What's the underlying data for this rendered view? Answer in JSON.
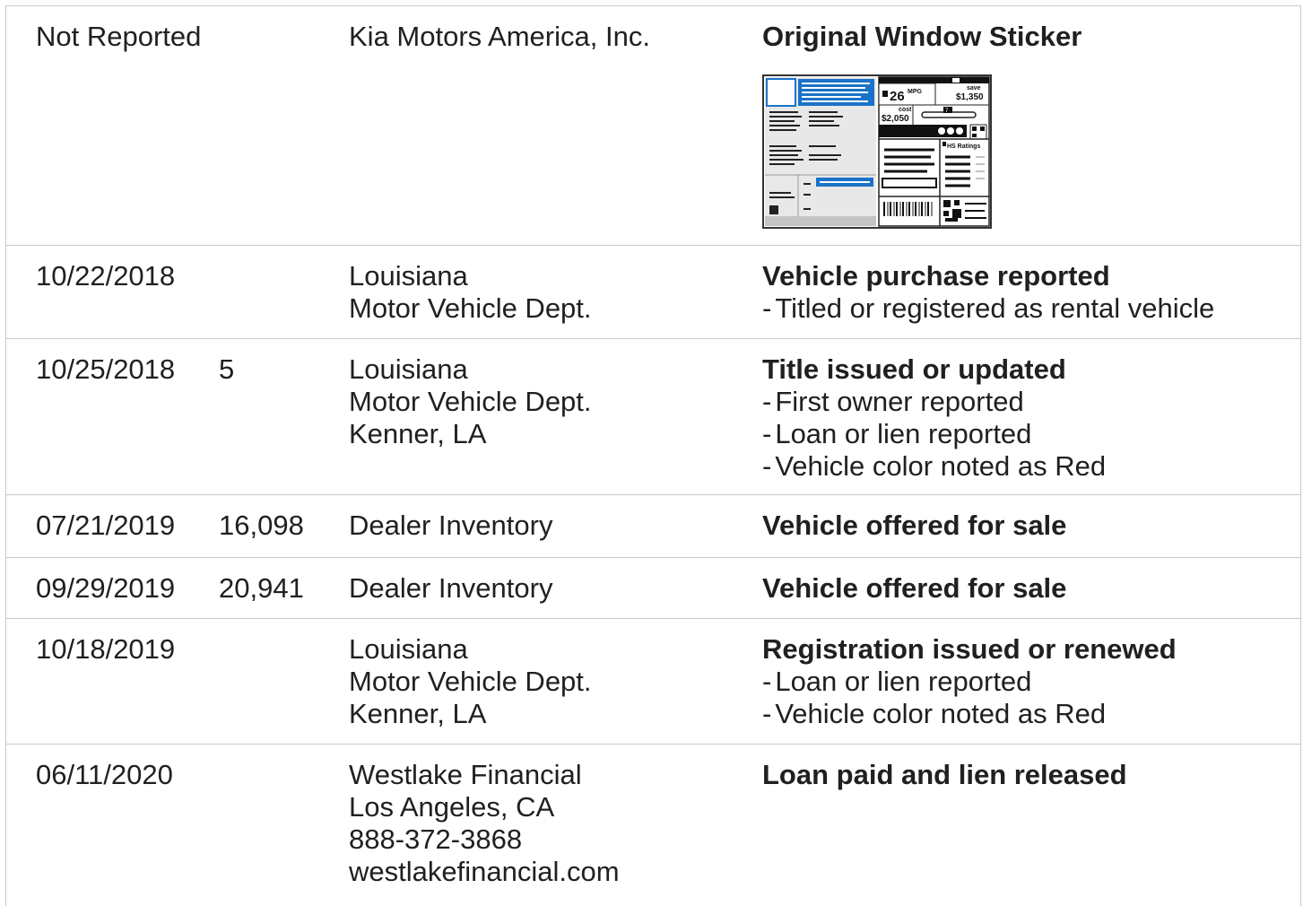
{
  "rows": [
    {
      "date": "Not Reported",
      "odometer": "",
      "source": [
        "Kia Motors America, Inc."
      ],
      "comment_title": "Original Window Sticker",
      "comment_details": [],
      "sticker": {
        "mpg": "26",
        "mpg_unit": "MPG",
        "save_label": "save",
        "save_amount": "$1,350",
        "cost_label": "cost",
        "cost_amount": "$2,050",
        "ratings_label": "HS Ratings",
        "scale_value": "7"
      }
    },
    {
      "date": "10/22/2018",
      "odometer": "",
      "source": [
        "Louisiana",
        "Motor Vehicle Dept."
      ],
      "comment_title": "Vehicle purchase reported",
      "comment_details": [
        "Titled or registered as rental vehicle"
      ]
    },
    {
      "date": "10/25/2018",
      "odometer": "5",
      "source": [
        "Louisiana",
        "Motor Vehicle Dept.",
        "Kenner, LA"
      ],
      "comment_title": "Title issued or updated",
      "comment_details": [
        "First owner reported",
        "Loan or lien reported",
        "Vehicle color noted as Red"
      ]
    },
    {
      "date": "07/21/2019",
      "odometer": "16,098",
      "source": [
        "Dealer Inventory"
      ],
      "comment_title": "Vehicle offered for sale",
      "comment_details": []
    },
    {
      "date": "09/29/2019",
      "odometer": "20,941",
      "source": [
        "Dealer Inventory"
      ],
      "comment_title": "Vehicle offered for sale",
      "comment_details": []
    },
    {
      "date": "10/18/2019",
      "odometer": "",
      "source": [
        "Louisiana",
        "Motor Vehicle Dept.",
        "Kenner, LA"
      ],
      "comment_title": "Registration issued or renewed",
      "comment_details": [
        "Loan or lien reported",
        "Vehicle color noted as Red"
      ]
    },
    {
      "date": "06/11/2020",
      "odometer": "",
      "source": [
        "Westlake Financial",
        "Los Angeles, CA",
        "888-372-3868",
        "westlakefinancial.com"
      ],
      "comment_title": "Loan paid and lien released",
      "comment_details": []
    }
  ],
  "colors": {
    "text": "#202020",
    "border": "#c8c8c8",
    "sticker_blue": "#1a73c8"
  },
  "icons": {
    "detail_bullet": "-"
  }
}
